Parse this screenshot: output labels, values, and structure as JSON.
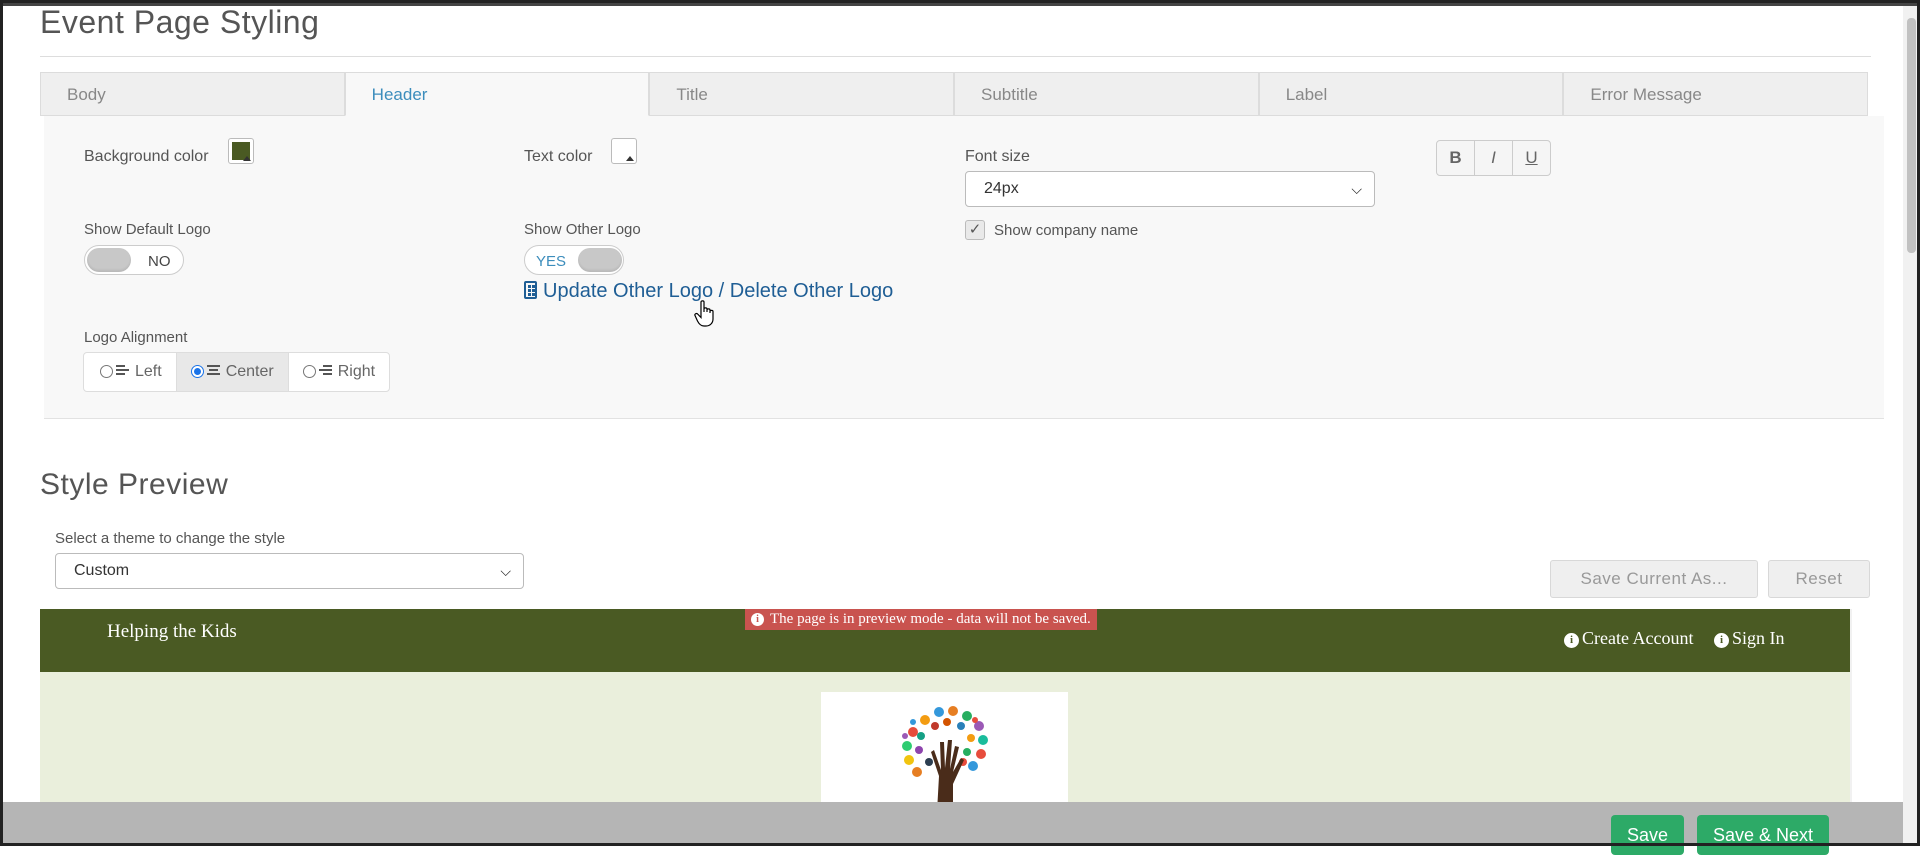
{
  "page": {
    "title": "Event Page Styling"
  },
  "tabs": [
    {
      "label": "Body"
    },
    {
      "label": "Header",
      "active": true
    },
    {
      "label": "Title"
    },
    {
      "label": "Subtitle"
    },
    {
      "label": "Label"
    },
    {
      "label": "Error Message"
    }
  ],
  "header_settings": {
    "background_color_label": "Background color",
    "background_color": "#4a5a23",
    "text_color_label": "Text color",
    "text_color": "#ffffff",
    "font_size_label": "Font size",
    "font_size_value": "24px",
    "format_buttons": {
      "bold": "B",
      "italic": "I",
      "underline": "U"
    },
    "show_default_logo_label": "Show Default Logo",
    "show_default_logo_state": "NO",
    "show_other_logo_label": "Show Other Logo",
    "show_other_logo_state": "YES",
    "update_logo_link": "Update Other Logo / Delete Other Logo",
    "show_company_name_label": "Show company name",
    "show_company_name_checked": true,
    "logo_alignment_label": "Logo Alignment",
    "logo_alignment_options": [
      "Left",
      "Center",
      "Right"
    ],
    "logo_alignment_selected": "Center"
  },
  "preview": {
    "section_title": "Style Preview",
    "theme_label": "Select a theme to change the style",
    "theme_value": "Custom",
    "save_current_as": "Save Current As...",
    "reset": "Reset",
    "brand": "Helping the Kids",
    "alert": "The page is in preview mode - data will not be saved.",
    "nav": {
      "create_account": "Create Account",
      "sign_in": "Sign In"
    },
    "body_color": "#eaefdc"
  },
  "footer": {
    "save": "Save",
    "save_next": "Save & Next",
    "button_color": "#2daa67"
  }
}
